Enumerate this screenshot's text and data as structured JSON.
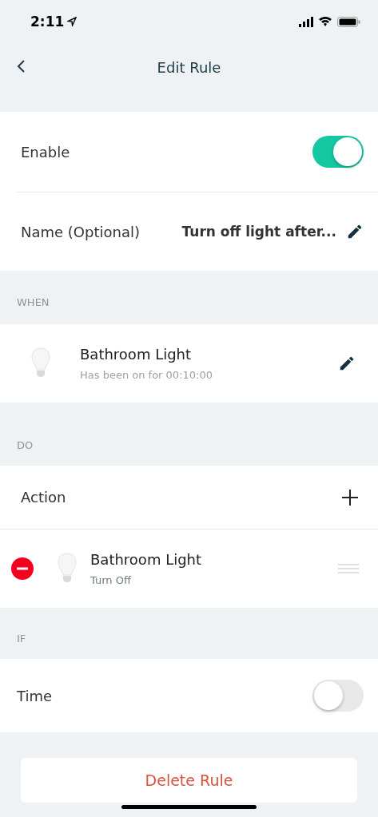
{
  "status_bar": {
    "time": "2:11"
  },
  "nav": {
    "title": "Edit Rule"
  },
  "settings": {
    "enable": {
      "label": "Enable",
      "on": true
    },
    "name": {
      "label": "Name (Optional)",
      "value": "Turn off light after..."
    }
  },
  "when": {
    "header": "WHEN",
    "device": "Bathroom Light",
    "condition": "Has been on for 00:10:00"
  },
  "do": {
    "header": "DO",
    "action_label": "Action",
    "actions": [
      {
        "device": "Bathroom Light",
        "command": "Turn Off"
      }
    ]
  },
  "if": {
    "header": "IF",
    "time": {
      "label": "Time",
      "on": false
    }
  },
  "delete_button": "Delete Rule"
}
